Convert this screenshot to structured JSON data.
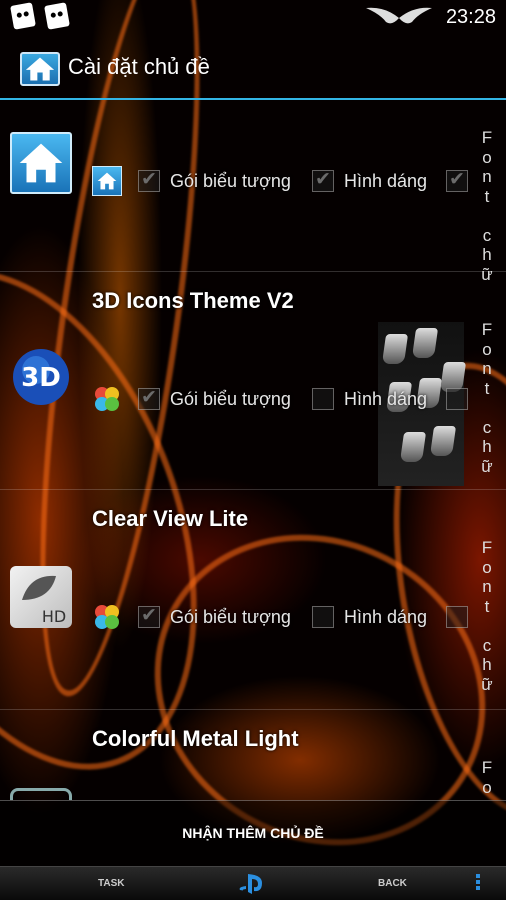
{
  "status_bar": {
    "time": "23:28"
  },
  "header": {
    "title": "Cài đặt chủ đề"
  },
  "options": {
    "icon_pack": "Gói biểu tượng",
    "shape": "Hình dáng",
    "font": "Font chữ",
    "font_letters": [
      "F",
      "o",
      "n",
      "t",
      "",
      "c",
      "h",
      "ữ"
    ]
  },
  "themes": [
    {
      "name": "",
      "icon": "default-home-icon",
      "icon_pack": true,
      "shape": true,
      "font": true
    },
    {
      "name": "3D Icons Theme V2",
      "icon": "3d-globe-icon",
      "icon_pack": true,
      "shape": false,
      "font": false
    },
    {
      "name": "Clear View Lite",
      "icon": "leaf-hd-icon",
      "icon_pack": true,
      "shape": false,
      "font": false
    },
    {
      "name": "Colorful Metal Light",
      "icon": "metal-icon"
    }
  ],
  "footer": {
    "get_more": "NHẬN THÊM CHỦ ĐỀ"
  },
  "navbar": {
    "task": "TASK",
    "back": "BACK"
  },
  "colors": {
    "accent": "#33b5e5",
    "nav_accent": "#2b8fe0"
  }
}
